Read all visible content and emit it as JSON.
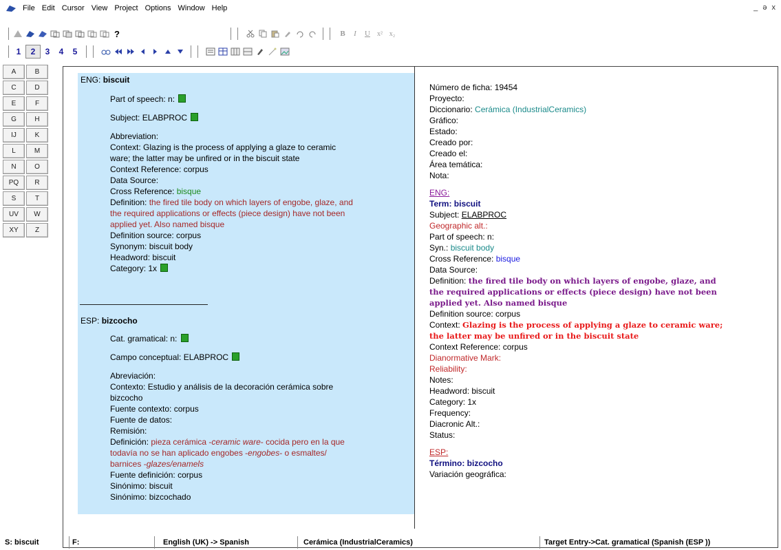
{
  "menu": [
    "File",
    "Edit",
    "Cursor",
    "View",
    "Project",
    "Options",
    "Window",
    "Help"
  ],
  "window_controls": "_ ə x",
  "toolbar2": {
    "help_label": "?"
  },
  "toolbar3": {
    "numbers": [
      "1",
      "2",
      "3",
      "4",
      "5"
    ],
    "selected": "2"
  },
  "letters": [
    [
      "A",
      "B"
    ],
    [
      "C",
      "D"
    ],
    [
      "E",
      "F"
    ],
    [
      "G",
      "H"
    ],
    [
      "IJ",
      "K"
    ],
    [
      "L",
      "M"
    ],
    [
      "N",
      "O"
    ],
    [
      "PQ",
      "R"
    ],
    [
      "S",
      "T"
    ],
    [
      "UV",
      "W"
    ],
    [
      "XY",
      "Z"
    ]
  ],
  "left": {
    "eng_prefix": "ENG:",
    "eng_term": "biscuit",
    "pos": "Part of speech: n:",
    "subject": "Subject: ELABPROC",
    "abbr": "Abbreviation:",
    "context_1": "Context: Glazing is the process of applying a glaze to ceramic",
    "context_2": "ware; the latter may be unfired or in the biscuit state",
    "context_ref": "Context Reference: corpus",
    "data_source": "Data Source:",
    "cross_label": "Cross Reference:",
    "cross_value": "bisque",
    "def_label": "Definition:",
    "def_1": "the fired tile body on which layers of engobe, glaze, and",
    "def_2": "the required applications or effects (piece design) have not been",
    "def_3": "applied yet. Also named bisque",
    "def_source": "Definition source: corpus",
    "synonym": "Synonym: biscuit body",
    "headword": "Headword: biscuit",
    "category": "Category: 1x",
    "esp_prefix": "ESP:",
    "esp_term": "bizcocho",
    "cat_gram": "Cat. gramatical: n:",
    "campo": "Campo conceptual: ELABPROC",
    "abrev": "Abreviación:",
    "contexto_1": "Contexto:  Estudio y análisis de la decoración cerámica sobre",
    "contexto_2": "bizcocho",
    "fuente_ctx": "Fuente contexto: corpus",
    "fuente_datos": "Fuente de datos:",
    "remision": "Remisión:",
    "defn_label": "Definición:",
    "defn_1a": "pieza cerámica -",
    "defn_1b": "ceramic ware",
    "defn_1c": "- cocida pero en la que",
    "defn_2a": "todavía no se han aplicado engobes -",
    "defn_2b": "engobes",
    "defn_2c": "- o esmaltes/",
    "defn_3a": "barnices -",
    "defn_3b": "glazes/enamels",
    "fuente_def": "Fuente definición: corpus",
    "sin_1": "Sinónimo: biscuit",
    "sin_2": "Sinónimo: bizcochado"
  },
  "right": {
    "ficha": "Número de ficha: 19454",
    "proyecto": "Proyecto:",
    "dicc_label": "Diccionario:",
    "dicc_value": "Cerámica (IndustrialCeramics)",
    "grafico": "Gráfico:",
    "estado": "Estado:",
    "creado_por": "Creado por:",
    "creado_el": "Creado el:",
    "area": "Área temática:",
    "nota": "Nota:",
    "eng_link": "ENG:",
    "term": "Term: biscuit",
    "subject_label": "Subject:",
    "subject_value": "ELABPROC",
    "geo_alt": "Geographic alt.:",
    "pos": "Part of speech: n:",
    "syn_label": "Syn.:",
    "syn_value": "biscuit body",
    "cross_label": "Cross Reference:",
    "cross_value": "bisque",
    "data_source": "Data Source:",
    "def_label": "Definition:",
    "def_1": "the fired tile body on which layers of engobe, glaze, and",
    "def_2": "the required applications or effects (piece design) have not been",
    "def_3": "applied yet. Also named bisque",
    "def_source": "Definition source: corpus",
    "ctx_label": "Context:",
    "ctx_1": "Glazing is the process of applying a glaze to ceramic ware;",
    "ctx_2": "the latter may be unfired or in the biscuit state",
    "ctx_ref": "Context Reference: corpus",
    "dianorm": "Dianormative Mark:",
    "reliab": "Reliability:",
    "notes": "Notes:",
    "headword": "Headword: biscuit",
    "category": "Category: 1x",
    "frequency": "Frequency:",
    "diacronic": "Diacronic Alt.:",
    "status": "Status:",
    "esp_link": "ESP:",
    "termino": "Término: bizcocho",
    "variacion": "Variación geográfica:"
  },
  "status": {
    "s": "S: biscuit",
    "f": "F:",
    "lang": "English (UK) -> Spanish",
    "dict": "Cerámica (IndustrialCeramics)",
    "target": "Target Entry->Cat. gramatical (Spanish (ESP ))"
  }
}
